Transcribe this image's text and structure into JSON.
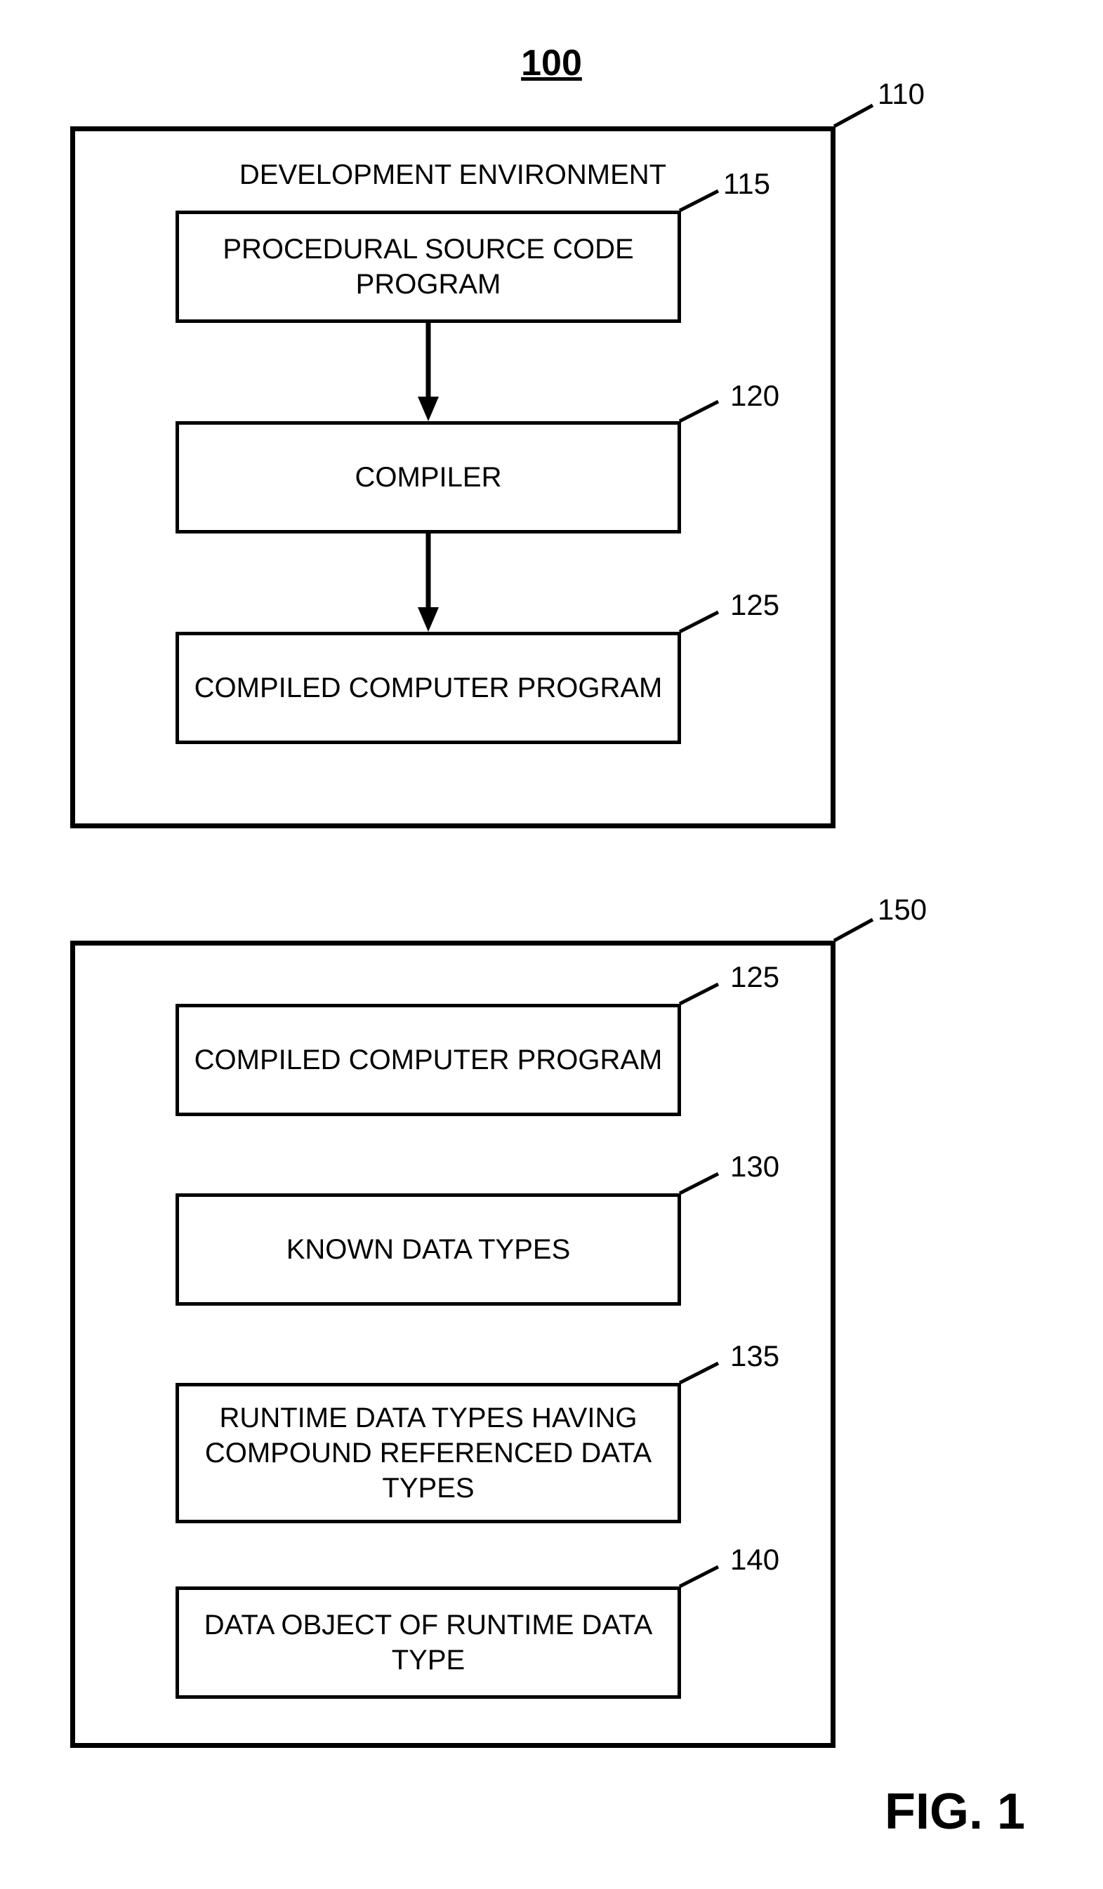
{
  "figure_number": "100",
  "figure_caption": "FIG. 1",
  "env_box": {
    "title": "DEVELOPMENT ENVIRONMENT",
    "ref": "110",
    "boxes": {
      "source": {
        "label": "PROCEDURAL SOURCE CODE PROGRAM",
        "ref": "115"
      },
      "compiler": {
        "label": "COMPILER",
        "ref": "120"
      },
      "compiled": {
        "label": "COMPILED COMPUTER PROGRAM",
        "ref": "125"
      }
    }
  },
  "runtime_box": {
    "ref": "150",
    "boxes": {
      "compiled": {
        "label": "COMPILED COMPUTER PROGRAM",
        "ref": "125"
      },
      "known": {
        "label": "KNOWN DATA TYPES",
        "ref": "130"
      },
      "runtime": {
        "label": "RUNTIME DATA TYPES HAVING COMPOUND REFERENCED DATA TYPES",
        "ref": "135"
      },
      "dataobj": {
        "label": "DATA OBJECT OF RUNTIME DATA TYPE",
        "ref": "140"
      }
    }
  }
}
